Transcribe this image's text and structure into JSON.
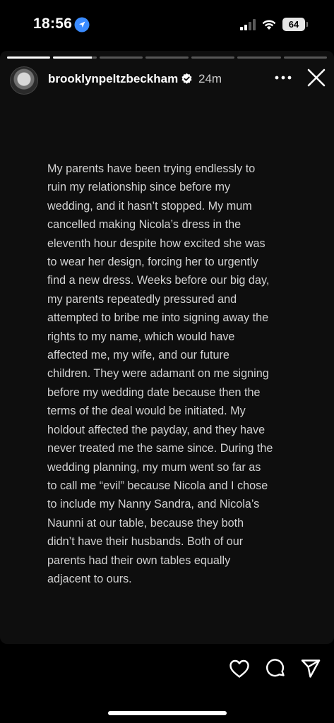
{
  "status_bar": {
    "time": "18:56",
    "battery": "64",
    "icons": [
      "location-arrow-icon",
      "signal-icon",
      "wifi-icon",
      "battery-icon"
    ]
  },
  "story": {
    "progress": {
      "segments": 7,
      "current_index": 1,
      "current_fraction": 0.9
    },
    "username": "brooklynpeltzbeckham",
    "verified_icon": "verified-badge-icon",
    "time_ago": "24m",
    "menu_icon": "more-horizontal-icon",
    "close_icon": "close-icon",
    "text": "My parents have been trying endlessly to\nruin my relationship since before my\nwedding, and it hasn’t stopped. My mum\ncancelled making Nicola’s dress in the\neleventh hour despite how excited she was\nto wear her design, forcing her to urgently\nfind a new dress. Weeks before our big day,\nmy parents repeatedly pressured and\nattempted to bribe me into signing away the\nrights to my name, which would have\naffected me, my wife, and our future\nchildren. They were adamant on me signing\nbefore my wedding date because then the\nterms of the deal would be initiated. My\nholdout affected the payday, and they have\nnever treated me the same since. During the\nwedding planning, my mum went so far as\nto call me “evil” because Nicola and I chose\nto include my Nanny Sandra, and Nicola’s\nNaunni at our table, because they both\ndidn’t have their husbands. Both of our\nparents had their own tables equally\nadjacent to ours."
  },
  "actions": {
    "icons": [
      "heart-icon",
      "comment-icon",
      "send-icon"
    ]
  },
  "colors": {
    "background": "#000000",
    "story_background": "#0e0e0e",
    "text": "#d2d2d2",
    "verified": "#ffffff"
  }
}
